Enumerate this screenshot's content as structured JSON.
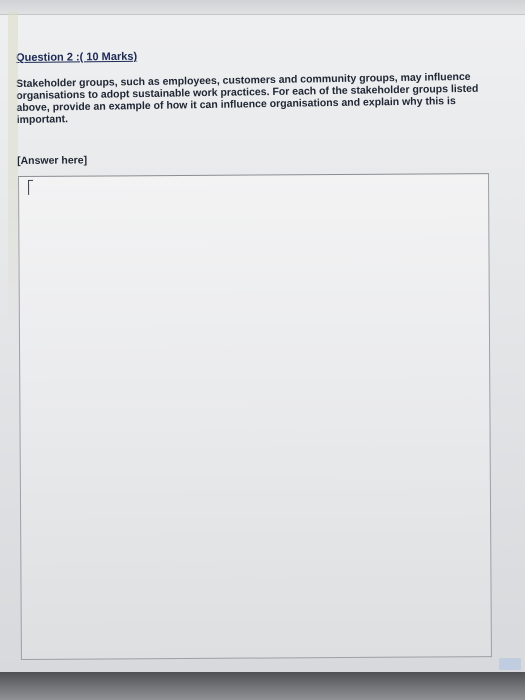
{
  "question": {
    "title": "Question 2 :( 10 Marks)",
    "body": "Stakeholder groups, such as employees, customers and community groups, may influence organisations to adopt sustainable work practices. For each of the stakeholder groups listed above, provide an example of how it can influence organisations and explain why this is important."
  },
  "answer": {
    "label": "[Answer here]",
    "value": ""
  },
  "colors": {
    "title": "#1c2a55",
    "text": "#202734",
    "box_border": "#9da0a5"
  }
}
